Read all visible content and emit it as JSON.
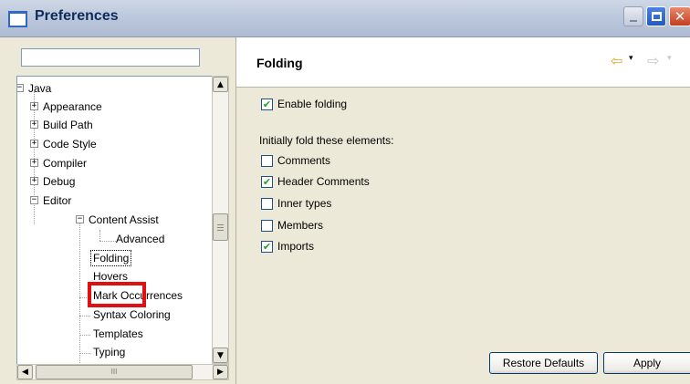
{
  "window": {
    "title": "Preferences",
    "close_glyph": "✕"
  },
  "filter": {
    "value": "",
    "placeholder": ""
  },
  "tree": {
    "java": "Java",
    "appearance": "Appearance",
    "build_path": "Build Path",
    "code_style": "Code Style",
    "compiler": "Compiler",
    "debug": "Debug",
    "editor": "Editor",
    "content_assist": "Content Assist",
    "advanced": "Advanced",
    "folding": "Folding",
    "hovers": "Hovers",
    "mark_occurrences": "Mark Occurrences",
    "syntax_coloring": "Syntax Coloring",
    "templates": "Templates",
    "typing": "Typing",
    "expanded_glyph": "−",
    "collapsed_glyph": "+",
    "selected": "Folding",
    "highlight_color": "#e01010"
  },
  "scroll": {
    "up": "▲",
    "down": "▼",
    "left": "◀",
    "right": "▶",
    "hgrip": "III"
  },
  "page": {
    "title": "Folding",
    "nav_back_icon": "back-arrow-icon",
    "nav_forward_icon": "forward-arrow-icon",
    "nav_back": "⇦",
    "nav_forward": "⇨",
    "nav_dropdown": "▾",
    "enable_folding": {
      "label": "Enable folding",
      "checked": true
    },
    "section_label": "Initially fold these elements:",
    "elements": [
      {
        "label": "Comments",
        "checked": false
      },
      {
        "label": "Header Comments",
        "checked": true
      },
      {
        "label": "Inner types",
        "checked": false
      },
      {
        "label": "Members",
        "checked": false
      },
      {
        "label": "Imports",
        "checked": true
      }
    ],
    "check_glyph": "✔",
    "restore_defaults": "Restore Defaults",
    "apply": "Apply"
  }
}
